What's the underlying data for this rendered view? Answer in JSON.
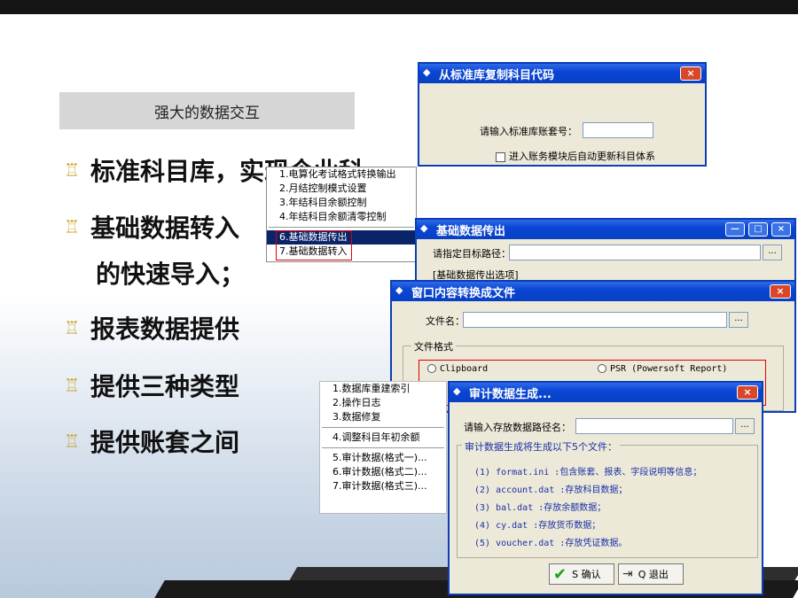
{
  "slide": {
    "subtitle": "强大的数据交互",
    "bullet_mark": "♖",
    "bullets": [
      {
        "text": "标准科目库，实现企业科"
      },
      {
        "text": "基础数据转入"
      },
      {
        "text": "报表数据提供"
      },
      {
        "text": "提供三种类型"
      },
      {
        "text": "提供账套之间"
      }
    ],
    "continuation": "的快速导入；"
  },
  "menu1": {
    "items": [
      "1.电算化考试格式转换输出",
      "2.月结控制模式设置",
      "3.年结科目余额控制",
      "4.年结科目余额清零控制",
      "6.基础数据传出",
      "7.基础数据转入"
    ]
  },
  "menu2": {
    "items": [
      "1.数据库重建索引",
      "2.操作日志",
      "3.数据修复",
      "4.调整科目年初余额",
      "5.审计数据(格式一)...",
      "6.审计数据(格式二)...",
      "7.审计数据(格式三)..."
    ]
  },
  "dlg_copy": {
    "title": "从标准库复制科目代码",
    "close": "×",
    "prompt": "请输入标准库账套号：",
    "checkbox_label": "进入账务模块后自动更新科目体系"
  },
  "dlg_export": {
    "title": "基础数据传出",
    "close": "×",
    "min": "—",
    "max": "□",
    "path_label": "请指定目标路径：",
    "browse": "...",
    "group_label": "[基础数据传出选项]"
  },
  "dlg_window": {
    "title": "窗口内容转换成文件",
    "close": "×",
    "file_label": "文件名：",
    "browse": "...",
    "format_label": "文件格式",
    "opt_clipboard": "Clipboard",
    "opt_psr": "PSR  (Powersoft Report)"
  },
  "dlg_audit": {
    "title": "审计数据生成...",
    "close": "×",
    "path_label": "请输入存放数据路径名：",
    "browse": "...",
    "info_title": "审计数据生成将生成以下5个文件：",
    "files": [
      "(1) format.ini  :包含账套、报表、字段说明等信息；",
      "(2) account.dat  :存放科目数据；",
      "(3) bal.dat  :存放余额数据；",
      "(4) cy.dat  :存放货币数据；",
      "(5) voucher.dat  :存放凭证数据。"
    ],
    "ok_label": "S 确认",
    "exit_label": "Q 退出",
    "ok_icon_glyph": "✔",
    "exit_icon_glyph": "⇥"
  },
  "colors": {
    "titlebar": "#0a46d4",
    "highlight": "#0a246a",
    "bullet_mark": "#c9a42a",
    "annotation_red": "#e00000"
  }
}
